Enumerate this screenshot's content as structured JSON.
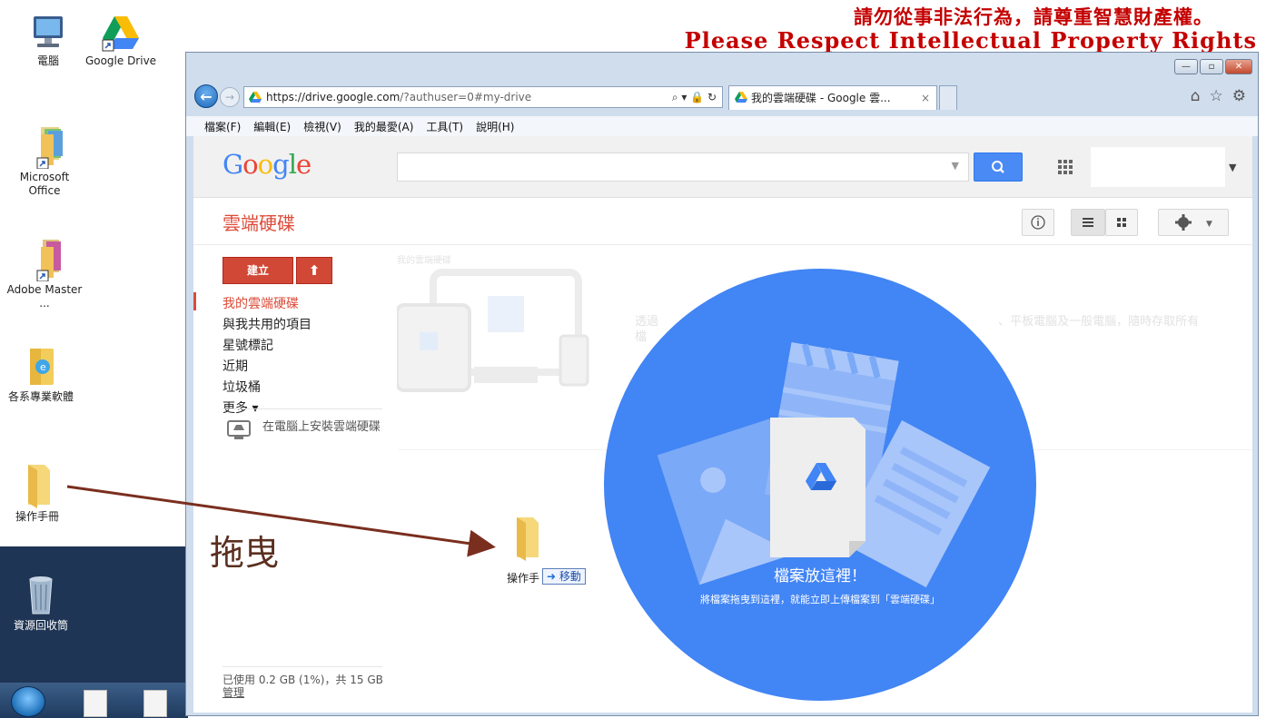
{
  "desktop": {
    "icons": [
      {
        "label": "電腦"
      },
      {
        "label": "Google Drive"
      },
      {
        "label": "Microsoft Office"
      },
      {
        "label": "Adobe Master ..."
      },
      {
        "label": "各系專業軟體"
      },
      {
        "label": "操作手冊"
      },
      {
        "label": "資源回收筒"
      }
    ],
    "banner": {
      "line1": "請勿從事非法行為，請尊重智慧財產權。",
      "line2": "Please Respect Intellectual Property Rights"
    }
  },
  "browser": {
    "address": {
      "scheme_host": "https://drive.google.com",
      "path": "/?authuser=0#my-drive",
      "tools": "⌕ ▾ 🔒 ↻"
    },
    "tab": {
      "title": "我的雲端硬碟 - Google 雲...",
      "close": "×"
    },
    "right_tools": {
      "home": "⌂",
      "star": "☆",
      "gear": "⚙"
    },
    "window_buttons": {
      "min": "—",
      "max": "▫",
      "close": "✕"
    },
    "menu": [
      {
        "label": "檔案(F)"
      },
      {
        "label": "編輯(E)"
      },
      {
        "label": "檢視(V)"
      },
      {
        "label": "我的最愛(A)"
      },
      {
        "label": "工具(T)"
      },
      {
        "label": "說明(H)"
      }
    ]
  },
  "drive": {
    "logo": {
      "G": "G",
      "o1": "o",
      "o2": "o",
      "g": "g",
      "l": "l",
      "e": "e"
    },
    "title": "雲端硬碟",
    "create_label": "建立",
    "upload_label": "⬆",
    "nav": [
      {
        "label": "我的雲端硬碟",
        "active": true
      },
      {
        "label": "與我共用的項目"
      },
      {
        "label": "星號標記"
      },
      {
        "label": "近期"
      },
      {
        "label": "垃圾桶"
      },
      {
        "label": "更多 ▾"
      }
    ],
    "install_label": "在電腦上安裝雲端硬碟",
    "storage": {
      "usage": "已使用 0.2 GB (1%)，共 15 GB",
      "manage": "管理"
    },
    "breadcrumb": "我的雲端硬碟",
    "faded_text_left": "透過",
    "faded_text_right": "、平板電腦及一般電腦，隨時存取所有",
    "faded_text_line2": "檔"
  },
  "drop_zone": {
    "title": "檔案放這裡！",
    "subtitle": "將檔案拖曳到這裡，就能立即上傳檔案到「雲端硬碟」"
  },
  "drag": {
    "annotation": "拖曳",
    "item_name": "操作手",
    "move_label": "移動"
  },
  "colors": {
    "drive_red": "#dd4b39",
    "drop_blue": "#4285f4",
    "arrow": "#7a2e1e",
    "banner_red": "#c40000"
  }
}
